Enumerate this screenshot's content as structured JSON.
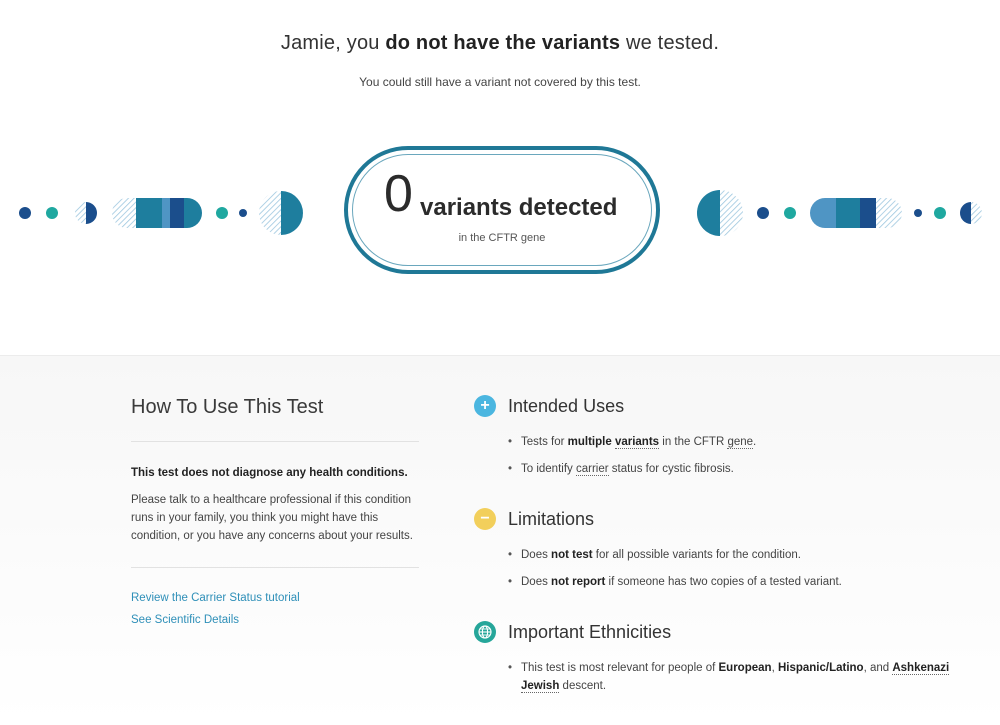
{
  "header": {
    "part1": "Jamie, you ",
    "bold": "do not have the variants",
    "part2": " we tested.",
    "subtitle": "You could still have a variant not covered by this test."
  },
  "result": {
    "count": "0",
    "label": "variants detected",
    "gene": "in the CFTR gene"
  },
  "how_to": {
    "title": "How To Use This Test",
    "bold_line": "This test does not diagnose any health conditions.",
    "paragraph": "Please talk to a healthcare professional if this condition runs in your family, you think you might have this condition, or you have any concerns about your results.",
    "links": [
      "Review the Carrier Status tutorial",
      "See Scientific Details"
    ]
  },
  "intended_uses": {
    "title": "Intended Uses",
    "icon": "plus-icon",
    "color": "#4bb6e0",
    "b1": {
      "a": "Tests for ",
      "b": "multiple",
      "c": " ",
      "d": "variants",
      "e": " in the CFTR ",
      "f": "gene",
      "g": "."
    },
    "b2": {
      "a": "To identify ",
      "b": "carrier",
      "c": " status for cystic fibrosis."
    }
  },
  "limitations": {
    "title": "Limitations",
    "icon": "minus-icon",
    "color": "#f2cf5b",
    "b1": {
      "a": "Does ",
      "b": "not test",
      "c": " for all possible variants for the condition."
    },
    "b2": {
      "a": "Does ",
      "b": "not report",
      "c": " if someone has two copies of a tested variant."
    }
  },
  "ethnicities": {
    "title": "Important Ethnicities",
    "icon": "globe-icon",
    "color": "#26a69a",
    "b1": {
      "a": "This test is most relevant for people of ",
      "b": "European",
      "c": ", ",
      "d": "Hispanic/Latino",
      "e": ", and ",
      "f": "Ashkenazi Jewish",
      "g": " descent."
    }
  },
  "colors": {
    "dark_blue": "#1b4e8c",
    "teal": "#1fa8a0",
    "mid_blue": "#1e7e9e",
    "light_blue": "#4f95c4",
    "pill_border": "#1f7896",
    "link": "#2e8fb8"
  }
}
